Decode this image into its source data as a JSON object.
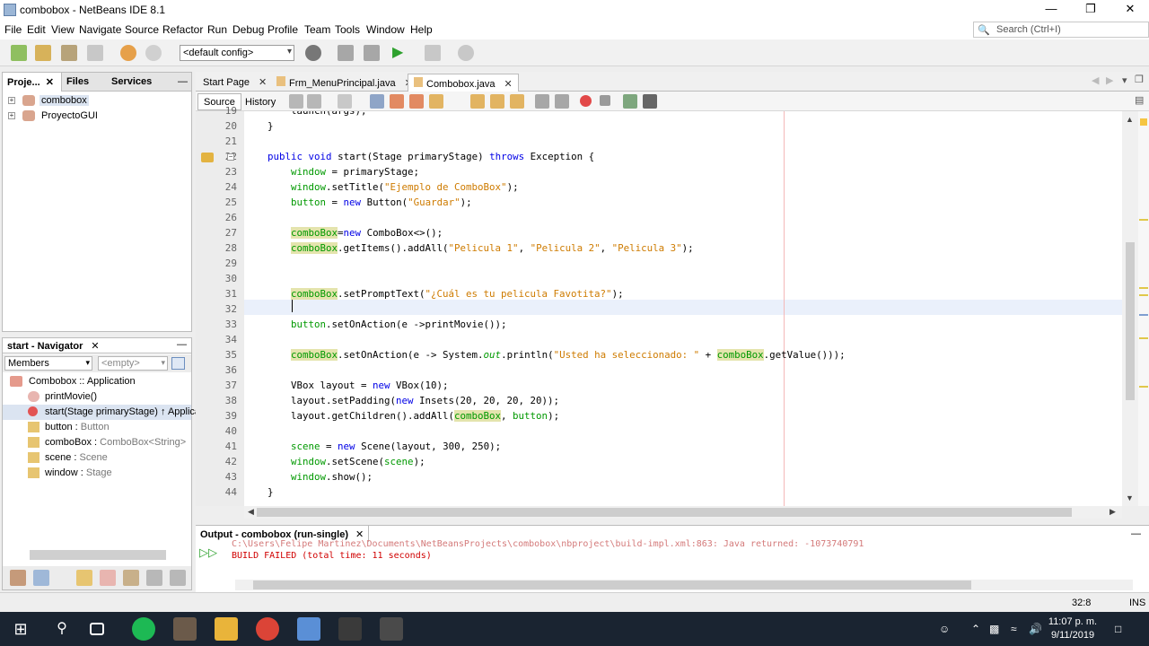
{
  "window": {
    "title": "combobox - NetBeans IDE 8.1",
    "minimize": "—",
    "maximize": "❐",
    "close": "✕"
  },
  "menu": [
    "File",
    "Edit",
    "View",
    "Navigate",
    "Source",
    "Refactor",
    "Run",
    "Debug",
    "Profile",
    "Team",
    "Tools",
    "Window",
    "Help"
  ],
  "search": {
    "placeholder": "Search (Ctrl+I)"
  },
  "toolbar": {
    "config": "<default config>"
  },
  "projects_panel": {
    "tabs": [
      "Proje...",
      "Files",
      "Services"
    ],
    "close": "✕",
    "items": [
      {
        "label": "combobox",
        "selected": true
      },
      {
        "label": "ProyectoGUI",
        "selected": false
      }
    ]
  },
  "navigator": {
    "title": "start - Navigator",
    "close": "✕",
    "filter": "Members",
    "filter2": "<empty>",
    "root": "Combobox :: Application",
    "items": [
      {
        "name": "printMovie()",
        "type": ""
      },
      {
        "name": "start(Stage primaryStage) ↑ Applicat",
        "type": ""
      },
      {
        "name": "button : ",
        "type": "Button"
      },
      {
        "name": "comboBox : ",
        "type": "ComboBox<String>"
      },
      {
        "name": "scene : ",
        "type": "Scene"
      },
      {
        "name": "window : ",
        "type": "Stage"
      }
    ]
  },
  "editor_tabs": [
    {
      "label": "Start Page",
      "active": false
    },
    {
      "label": "Frm_MenuPrincipal.java",
      "active": false
    },
    {
      "label": "Combobox.java",
      "active": true
    }
  ],
  "editor_toolbar": {
    "source": "Source",
    "history": "History"
  },
  "code": {
    "line_numbers": [
      "19",
      "20",
      "21",
      "22",
      "23",
      "24",
      "25",
      "26",
      "27",
      "28",
      "29",
      "30",
      "31",
      "32",
      "33",
      "34",
      "35",
      "36",
      "37",
      "38",
      "39",
      "40",
      "41",
      "42",
      "43",
      "44"
    ],
    "lines": [
      "        launch(args);",
      "    }",
      "",
      "    public void start(Stage primaryStage) throws Exception {",
      "        window = primaryStage;",
      "        window.setTitle(\"Ejemplo de ComboBox\");",
      "        button = new Button(\"Guardar\");",
      "",
      "        comboBox=new ComboBox<>();",
      "        comboBox.getItems().addAll(\"Pelicula 1\", \"Pelicula 2\", \"Pelicula 3\");",
      "",
      "",
      "        comboBox.setPromptText(\"¿Cuál es tu pelicula Favotita?\");",
      "",
      "        button.setOnAction(e ->printMovie());",
      "",
      "        comboBox.setOnAction(e -> System.out.println(\"Usted ha seleccionado: \" + comboBox.getValue()));",
      "",
      "        VBox layout = new VBox(10);",
      "        layout.setPadding(new Insets(20, 20, 20, 20));",
      "        layout.getChildren().addAll(comboBox, button);",
      "",
      "        scene = new Scene(layout, 300, 250);",
      "        window.setScene(scene);",
      "        window.show();",
      "    }"
    ]
  },
  "output": {
    "title": "Output - combobox (run-single)",
    "close": "✕",
    "lines": [
      "C:\\Users\\Felipe Martinez\\Documents\\NetBeansProjects\\combobox\\nbproject\\build-impl.xml:863: Java returned: -1073740791",
      "BUILD FAILED (total time: 11 seconds)"
    ]
  },
  "status": {
    "position": "32:8",
    "mode": "INS"
  },
  "taskbar": {
    "time": "11:07 p. m.",
    "date": "9/11/2019"
  },
  "colors": {
    "keyword": "#0000e6",
    "string": "#ce7b00",
    "field": "#009900",
    "highlight": "#e4e4ad",
    "error": "#d00000"
  }
}
